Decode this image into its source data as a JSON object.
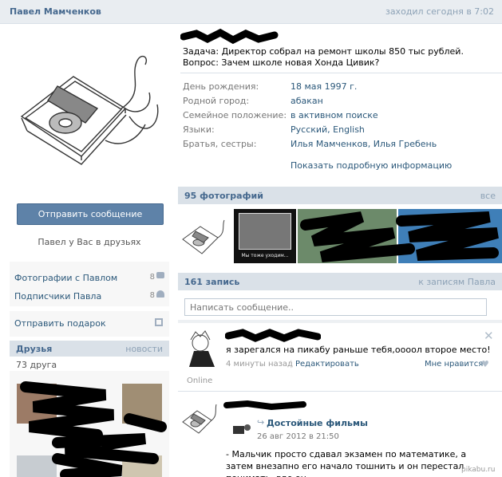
{
  "header": {
    "name": "Павел Мамченков",
    "status": "заходил сегодня в 7:02"
  },
  "profile": {
    "status_text": "Задача: Директор собрал на ремонт школы 850 тыс рублей. Вопрос: Зачем школе новая Хонда Цивик?",
    "info": [
      {
        "label": "День рождения:",
        "value": "18 мая 1997 г."
      },
      {
        "label": "Родной город:",
        "value": "абакан"
      },
      {
        "label": "Семейное положение:",
        "value": "в активном поиске"
      },
      {
        "label": "Языки:",
        "value": "Русский, English"
      },
      {
        "label": "Братья, сестры:",
        "value": "Илья Мамченков, Илья Гребень"
      }
    ],
    "show_more": "Показать подробную информацию"
  },
  "left": {
    "send_message": "Отправить сообщение",
    "friends_status": "Павел у Вас в друзьях",
    "links": [
      {
        "label": "Фотографии с Павлом",
        "count": "8",
        "icon": "camera-icon"
      },
      {
        "label": "Подписчики Павла",
        "count": "8",
        "icon": "people-icon"
      }
    ],
    "gift": "Отправить подарок",
    "friends_title": "Друзья",
    "friends_news": "новости",
    "friends_count": "73 друга"
  },
  "photos": {
    "title": "95 фотографий",
    "all": "все",
    "demotivator_caption": "Мы тоже уходим..."
  },
  "wall": {
    "title": "161 запись",
    "to_posts": "к записям Павла",
    "input_placeholder": "Написать сообщение..",
    "post1": {
      "text": "я зарегался на пикабу раньше тебя,оооол второе место!",
      "time": "4 минуты назад",
      "separator": "|",
      "edit": "Редактировать",
      "like": "Мне нравится",
      "online": "Online",
      "close": "✕"
    },
    "post2": {
      "repost_title": "Достойные фильмы",
      "repost_date": "26 авг 2012 в 21:50",
      "text": "- Мальчик просто сдавал экзамен по математике, а затем внезапно его начало тошнить и он перестал понимать, где он"
    }
  },
  "watermark": "pikabu.ru",
  "colors": {
    "accent": "#45688e",
    "link": "#2b587a",
    "button": "#5e82a8",
    "header_bg": "#e9edf1",
    "scribble": "#000000"
  }
}
